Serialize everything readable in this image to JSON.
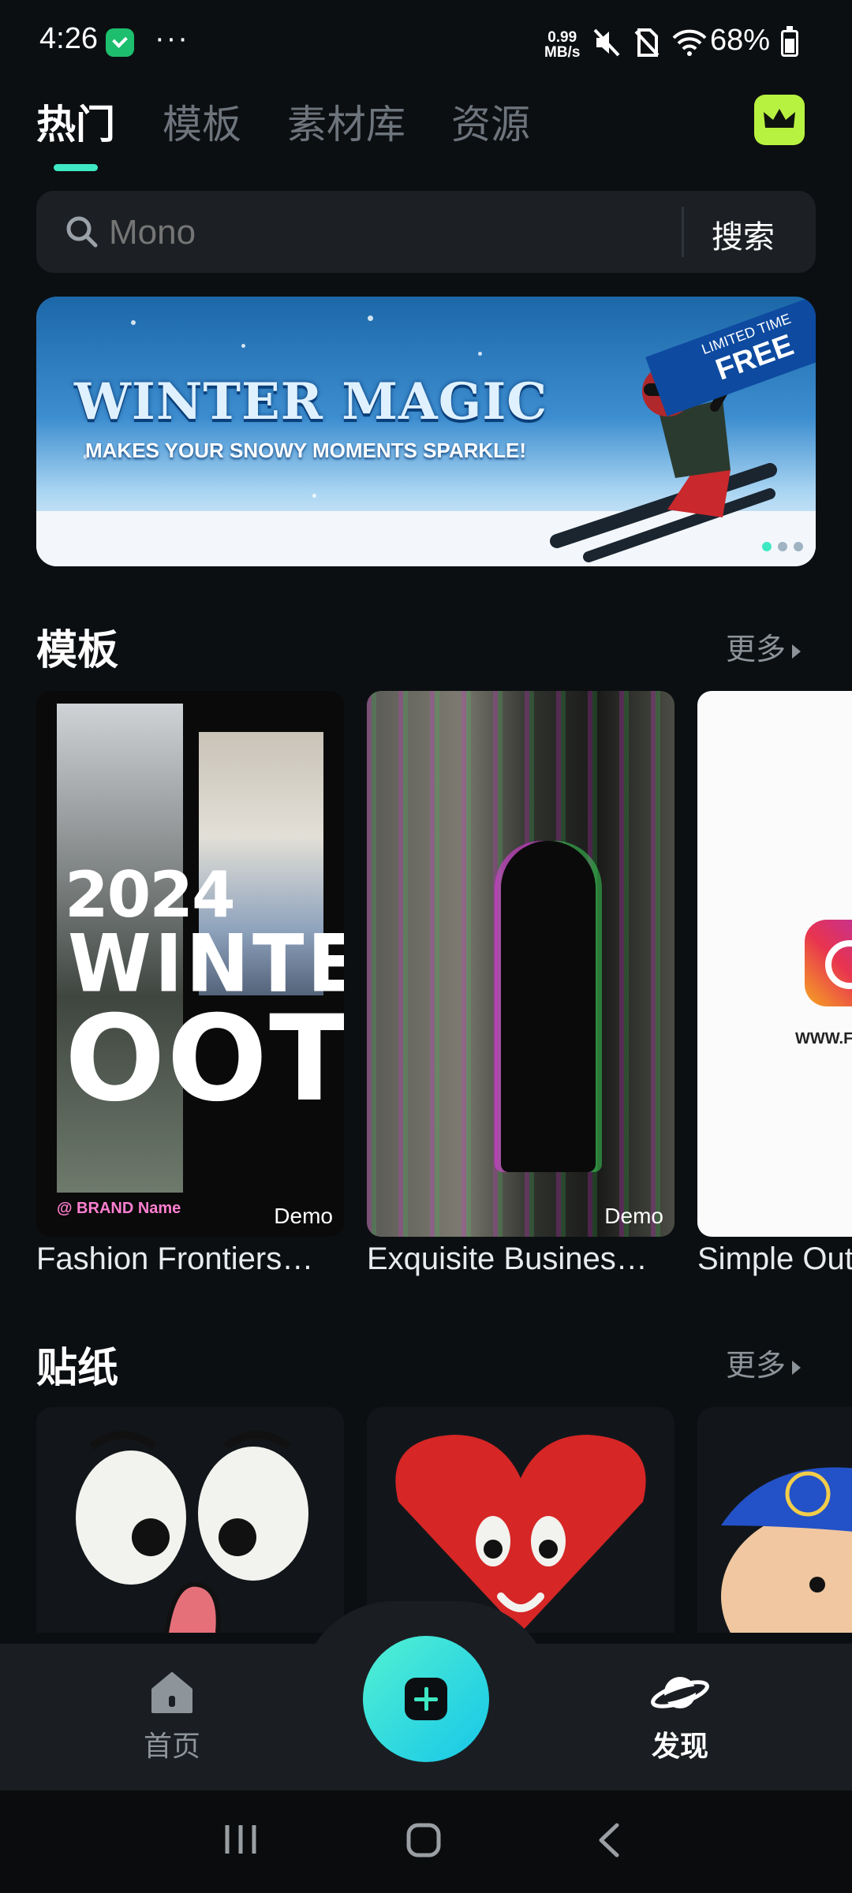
{
  "status_bar": {
    "time": "4:26",
    "more": "···",
    "speed": "0.99",
    "speed_unit": "MB/s",
    "battery": "68%"
  },
  "tabs": [
    {
      "label": "热门",
      "active": true
    },
    {
      "label": "模板",
      "active": false
    },
    {
      "label": "素材库",
      "active": false
    },
    {
      "label": "资源",
      "active": false
    }
  ],
  "search": {
    "placeholder": "Mono",
    "button_label": "搜索"
  },
  "banner": {
    "title": "WINTER MAGIC",
    "subtitle": "MAKES YOUR SNOWY MOMENTS SPARKLE!",
    "ribbon_top": "LIMITED TIME",
    "ribbon_main": "FREE",
    "page_count": 3,
    "active_page": 1
  },
  "templates_section": {
    "title": "模板",
    "more_label": "更多",
    "cards": [
      {
        "caption": "Fashion Frontiers…",
        "badge": "Demo",
        "year_text": "2024",
        "winter_text": "WINTER",
        "ootd_text": "OOTD",
        "brand_text": "@ BRAND Name"
      },
      {
        "caption": "Exquisite Busines…",
        "badge": "Demo"
      },
      {
        "caption": "Simple Out",
        "url_text": "WWW.FILM"
      }
    ]
  },
  "stickers_section": {
    "title": "贴纸",
    "more_label": "更多"
  },
  "bottom_nav": {
    "home_label": "首页",
    "discover_label": "发现",
    "active": "discover"
  },
  "colors": {
    "accent": "#3ee8c3",
    "background": "#0c0f12",
    "search_bg": "#1c2024",
    "vip_crown": "#b8f241"
  }
}
